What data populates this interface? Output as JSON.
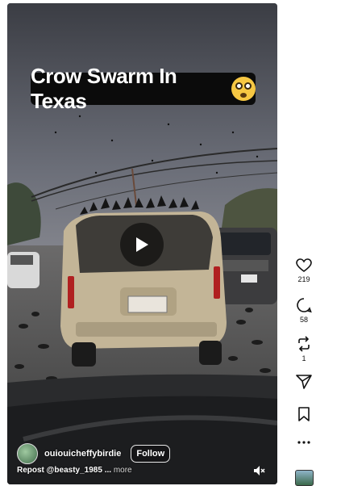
{
  "video": {
    "caption": "Crow Swarm In Texas",
    "caption_emoji": "flushed-face",
    "play_icon": "play-icon",
    "mute_icon": "speaker-muted-icon"
  },
  "author": {
    "username": "ouiouicheffybirdie",
    "follow_label": "Follow"
  },
  "description": {
    "text": "Repost @beasty_1985 ...",
    "more_label": "more"
  },
  "actions": {
    "like_count": "219",
    "comment_count": "58",
    "repost_count": "1",
    "icons": [
      "heart-icon",
      "comment-icon",
      "repost-icon",
      "share-icon",
      "bookmark-icon",
      "more-icon"
    ]
  },
  "colors": {
    "background": "#ffffff",
    "overlay": "#0b0b0b"
  }
}
